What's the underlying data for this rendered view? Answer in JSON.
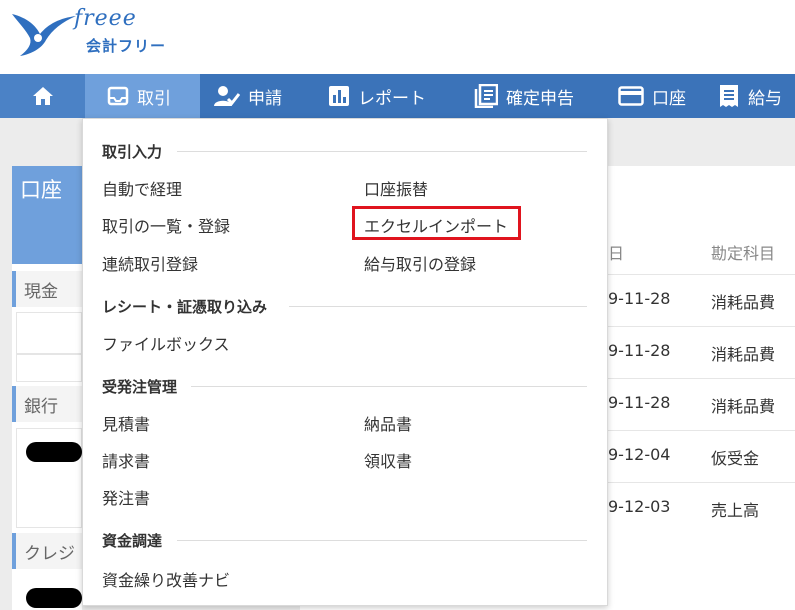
{
  "logo": {
    "brand": "freee",
    "product": "会計フリー"
  },
  "nav": {
    "home_icon": "home-icon",
    "items": [
      {
        "label": "取引",
        "icon": "inbox-icon"
      },
      {
        "label": "申請",
        "icon": "user-check-icon"
      },
      {
        "label": "レポート",
        "icon": "bar-chart-icon"
      },
      {
        "label": "確定申告",
        "icon": "document-stack-icon"
      },
      {
        "label": "口座",
        "icon": "credit-card-icon"
      },
      {
        "label": "給与",
        "icon": "receipt-icon"
      }
    ]
  },
  "sidebar": {
    "title": "口座",
    "sections": [
      {
        "label": "現金"
      },
      {
        "label": "銀行"
      },
      {
        "label": "クレジ"
      }
    ]
  },
  "table": {
    "headers": [
      "日",
      "勘定科目"
    ],
    "rows": [
      {
        "date": "9-11-28",
        "account": "消耗品費"
      },
      {
        "date": "9-11-28",
        "account": "消耗品費"
      },
      {
        "date": "9-11-28",
        "account": "消耗品費"
      },
      {
        "date": "9-12-04",
        "account": "仮受金"
      },
      {
        "date": "9-12-03",
        "account": "売上高"
      }
    ]
  },
  "dropdown": {
    "sections": [
      {
        "title": "取引入力",
        "items": [
          "自動で経理",
          "口座振替",
          "取引の一覧・登録",
          "エクセルインポート",
          "連続取引登録",
          "給与取引の登録"
        ]
      },
      {
        "title": "レシート・証憑取り込み",
        "items": [
          "ファイルボックス"
        ]
      },
      {
        "title": "受発注管理",
        "items": [
          "見積書",
          "納品書",
          "請求書",
          "領収書",
          "発注書"
        ]
      },
      {
        "title": "資金調達",
        "items": [
          "資金繰り改善ナビ"
        ]
      }
    ],
    "highlight_color": "#e0141e"
  },
  "colors": {
    "nav": "#3b73b9",
    "nav_active": "#6fa0dc",
    "brand": "#2f6fbf"
  }
}
